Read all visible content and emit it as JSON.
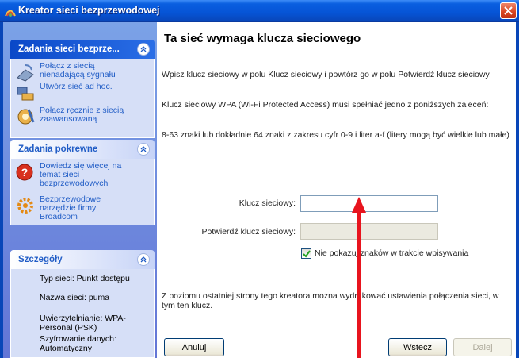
{
  "window": {
    "title": "Kreator sieci bezprzewodowej"
  },
  "sidebar": {
    "network_tasks": {
      "title": "Zadania sieci bezprze...",
      "items": [
        {
          "label": "Połącz z siecią nienadającą sygnału",
          "icon": "network-connect-icon"
        },
        {
          "label": "Utwórz sieć ad hoc.",
          "icon": "adhoc-network-icon"
        },
        {
          "label": "Połącz ręcznie z siecią zaawansowaną",
          "icon": "manual-connect-icon"
        }
      ]
    },
    "related_tasks": {
      "title": "Zadania pokrewne",
      "items": [
        {
          "label": "Dowiedz się więcej na temat sieci bezprzewodowych",
          "icon": "help-icon"
        },
        {
          "label": "Bezprzewodowe narzędzie firmy Broadcom",
          "icon": "broadcom-tool-icon"
        }
      ]
    },
    "details": {
      "title": "Szczegóły",
      "items": [
        "Typ sieci: Punkt dostępu",
        "Nazwa sieci: puma",
        "Uwierzytelnianie: WPA-Personal (PSK)",
        "Szyfrowanie danych: Automatyczny"
      ]
    }
  },
  "main": {
    "heading": "Ta sieć wymaga klucza sieciowego",
    "p1": "Wpisz klucz sieciowy w polu Klucz sieciowy i powtórz go w polu Potwierdź klucz sieciowy.",
    "p2": "Klucz sieciowy WPA (Wi-Fi Protected Access) musi spełniać jedno z poniższych zaleceń:",
    "p3": "8-63 znaki lub dokładnie 64 znaki z zakresu cyfr 0-9 i liter a-f (litery mogą być wielkie lub małe)",
    "key_label": "Klucz sieciowy:",
    "key_value": "",
    "confirm_label": "Potwierdź klucz sieciowy:",
    "confirm_value": "",
    "hide_chars_label": "Nie pokazuj znaków w trakcie wpisywania",
    "hide_chars_checked": true,
    "footer_text": "Z poziomu ostatniej strony tego kreatora można wydrukować ustawienia połączenia sieci, w tym ten klucz."
  },
  "buttons": {
    "cancel": "Anuluj",
    "back": "Wstecz",
    "next": "Dalej"
  },
  "colors": {
    "titlebar": "#0654d6",
    "link": "#215dc6",
    "annotation_arrow": "#e8141e"
  }
}
